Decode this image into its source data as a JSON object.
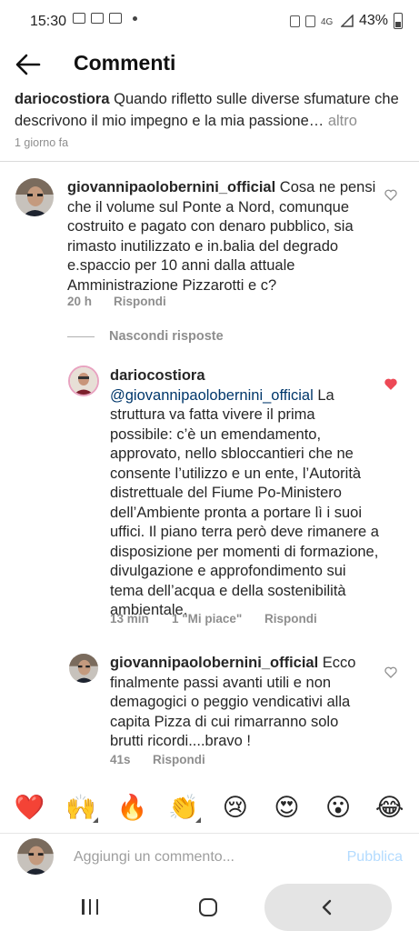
{
  "status_bar": {
    "time": "15:30",
    "battery": "43%"
  },
  "header": {
    "title": "Commenti"
  },
  "caption": {
    "username": "dariocostiora",
    "text": "Quando rifletto sulle diverse sfumature che descrivono il mio impegno e la mia passione…",
    "more": "altro",
    "time": "1 giorno fa"
  },
  "comments": [
    {
      "username": "giovannipaolobernini_official",
      "text": "Cosa ne pensi che il volume sul Ponte a Nord, comunque costruito e pagato con denaro pubblico, sia rimasto inutilizzato e in.balia del degrado e.spaccio per 10 anni dalla attuale Amministrazione Pizzarotti e c?",
      "time": "20 h",
      "reply": "Rispondi",
      "liked": false
    }
  ],
  "hide_replies": "Nascondi risposte",
  "replies": [
    {
      "username": "dariocostiora",
      "mention": "@giovannipaolobernini_official",
      "text": "La struttura va fatta vivere il prima possibile: c’è un emendamento, approvato, nello sbloccantieri che ne consente l’utilizzo e un ente, l’Autorità distrettuale del Fiume Po-Ministero dell’Ambiente pronta a portare lì i suoi uffici. Il piano terra però deve rimanere a disposizione per momenti di formazione, divulgazione e approfondimento sui tema dell’acqua e della sostenibilità ambientale.",
      "time": "13 min",
      "likes": "1 \"Mi piace\"",
      "reply": "Rispondi",
      "liked": true
    },
    {
      "username": "giovannipaolobernini_official",
      "text": "Ecco finalmente passi avanti utili e non demagogici o peggio vendicativi  alla capita Pizza di cui rimarranno solo brutti ricordi....bravo !",
      "time": "41s",
      "reply": "Rispondi",
      "liked": false
    }
  ],
  "reactions": [
    {
      "icon": "red-heart-icon",
      "glyph": "❤️"
    },
    {
      "icon": "raising-hands-icon",
      "glyph": "🙌"
    },
    {
      "icon": "fire-icon",
      "glyph": "🔥"
    },
    {
      "icon": "clapping-hands-icon",
      "glyph": "👏"
    },
    {
      "icon": "crying-face-icon",
      "glyph": "😢"
    },
    {
      "icon": "heart-eyes-icon",
      "glyph": "😍"
    },
    {
      "icon": "surprised-face-icon",
      "glyph": "😮"
    },
    {
      "icon": "laughing-face-icon",
      "glyph": "😂"
    }
  ],
  "input": {
    "placeholder": "Aggiungi un commento...",
    "publish": "Pubblica"
  },
  "colors": {
    "liked_heart": "#ed4956",
    "mention": "#00376b",
    "publish_disabled": "#b3dbff"
  }
}
